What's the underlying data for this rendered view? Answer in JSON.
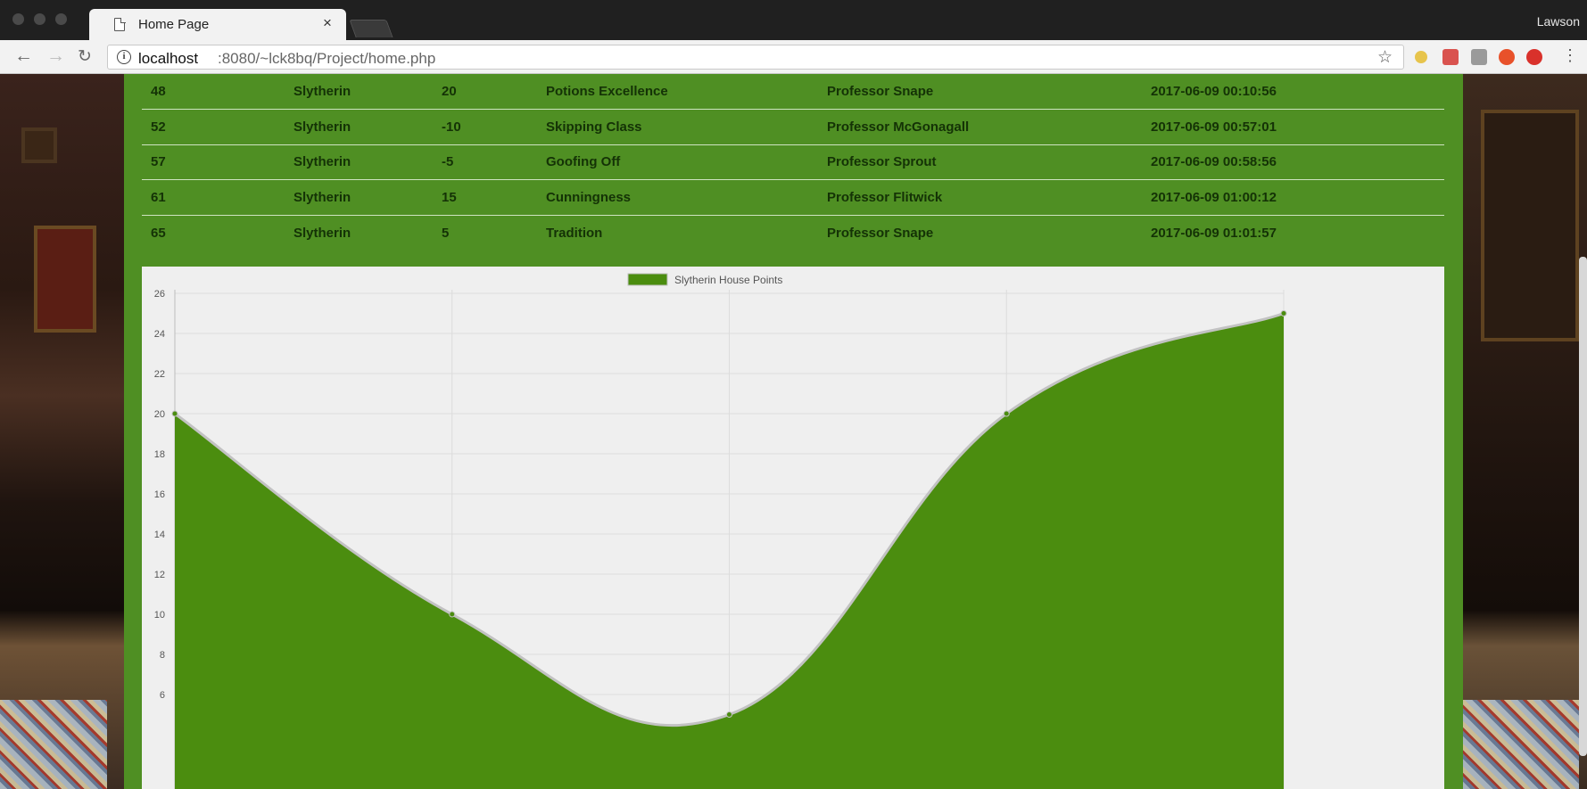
{
  "browser": {
    "tab_title": "Home Page",
    "tab_close": "×",
    "profile": "Lawson",
    "url_host": "localhost",
    "url_rest": ":8080/~lck8bq/Project/home.php",
    "info_icon": "i"
  },
  "table": {
    "rows": [
      [
        "48",
        "Slytherin",
        "20",
        "Potions Excellence",
        "Professor Snape",
        "2017-06-09 00:10:56"
      ],
      [
        "52",
        "Slytherin",
        "-10",
        "Skipping Class",
        "Professor McGonagall",
        "2017-06-09 00:57:01"
      ],
      [
        "57",
        "Slytherin",
        "-5",
        "Goofing Off",
        "Professor Sprout",
        "2017-06-09 00:58:56"
      ],
      [
        "61",
        "Slytherin",
        "15",
        "Cunningness",
        "Professor Flitwick",
        "2017-06-09 01:00:12"
      ],
      [
        "65",
        "Slytherin",
        "5",
        "Tradition",
        "Professor Snape",
        "2017-06-09 01:01:57"
      ]
    ]
  },
  "colors": {
    "house_green": "#4f8f23",
    "area_fill": "#4b8d0f",
    "line": "#c2c2c2",
    "chart_bg": "#efefef"
  },
  "chart_data": {
    "type": "area",
    "legend": "Slytherin House Points",
    "legend_position": "top",
    "series": [
      {
        "name": "Slytherin House Points",
        "values": [
          20,
          10,
          5,
          20,
          25
        ]
      }
    ],
    "y_ticks": [
      6,
      8,
      10,
      12,
      14,
      16,
      18,
      20,
      22,
      24,
      26
    ],
    "ylim": [
      4,
      26
    ],
    "grid": true,
    "smooth": true
  }
}
